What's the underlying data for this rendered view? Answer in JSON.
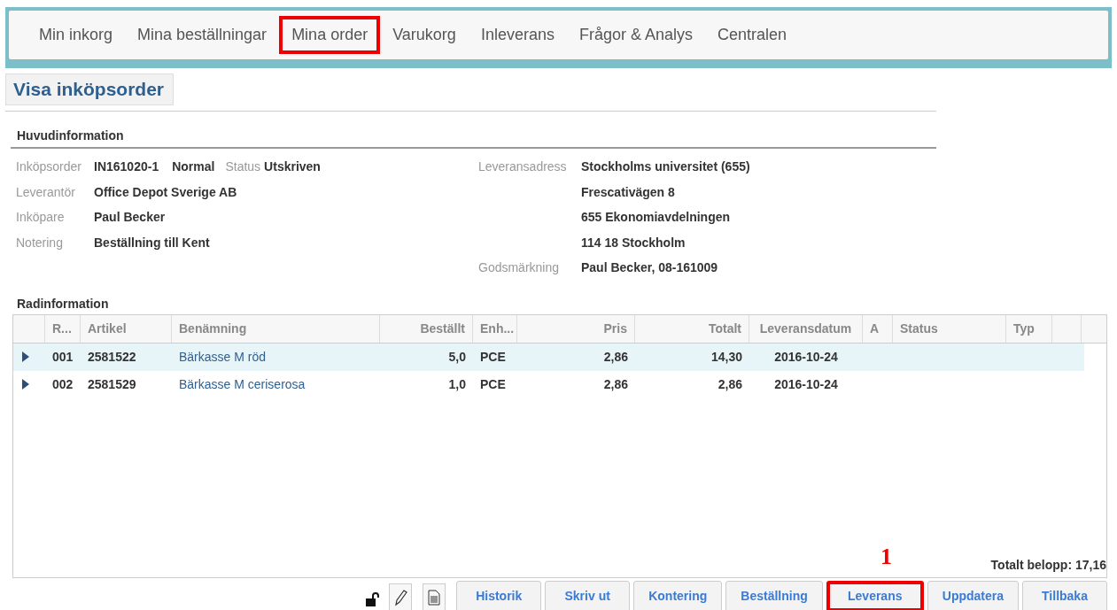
{
  "nav": [
    {
      "label": "Min inkorg",
      "highlighted": false
    },
    {
      "label": "Mina beställningar",
      "highlighted": false
    },
    {
      "label": "Mina order",
      "highlighted": true
    },
    {
      "label": "Varukorg",
      "highlighted": false
    },
    {
      "label": "Inleverans",
      "highlighted": false
    },
    {
      "label": "Frågor & Analys",
      "highlighted": false
    },
    {
      "label": "Centralen",
      "highlighted": false
    }
  ],
  "page_title": "Visa inköpsorder",
  "main_info": {
    "heading": "Huvudinformation",
    "left": [
      {
        "label": "Inköpsorder",
        "value": "IN161020-1",
        "extra_value": "Normal",
        "extra_label": "Status",
        "extra_value2": "Utskriven"
      },
      {
        "label": "Leverantör",
        "value": "Office Depot Sverige AB"
      },
      {
        "label": "Inköpare",
        "value": "Paul Becker"
      },
      {
        "label": "Notering",
        "value": "Beställning till Kent"
      }
    ],
    "right": [
      {
        "label": "Leveransadress",
        "value": "Stockholms universitet (655)"
      },
      {
        "value": "Frescativägen 8"
      },
      {
        "value": "655 Ekonomiavdelningen"
      },
      {
        "value": "114 18 Stockholm"
      },
      {
        "label": "Godsmärkning",
        "value": "Paul Becker, 08-161009"
      }
    ]
  },
  "lines": {
    "heading": "Radinformation",
    "columns": [
      "R...",
      "Artikel",
      "Benämning",
      "Beställt",
      "Enh...",
      "Pris",
      "Totalt",
      "Leveransdatum",
      "A",
      "Status",
      "Typ"
    ],
    "rows": [
      {
        "selected": true,
        "cells": [
          "001",
          "2581522",
          "Bärkasse M röd",
          "5,0",
          "PCE",
          "2,86",
          "14,30",
          "2016-10-24"
        ]
      },
      {
        "selected": false,
        "cells": [
          "002",
          "2581529",
          "Bärkasse M ceriserosa",
          "1,0",
          "PCE",
          "2,86",
          "2,86",
          "2016-10-24"
        ]
      }
    ],
    "total": "Totalt belopp: 17,16"
  },
  "callout": "1",
  "buttons": [
    {
      "label": "Historik",
      "highlighted": false
    },
    {
      "label": "Skriv ut",
      "highlighted": false
    },
    {
      "label": "Kontering",
      "highlighted": false
    },
    {
      "label": "Beställning",
      "highlighted": false
    },
    {
      "label": "Leverans",
      "highlighted": true
    },
    {
      "label": "Uppdatera",
      "highlighted": false
    },
    {
      "label": "Tillbaka",
      "highlighted": false
    }
  ]
}
